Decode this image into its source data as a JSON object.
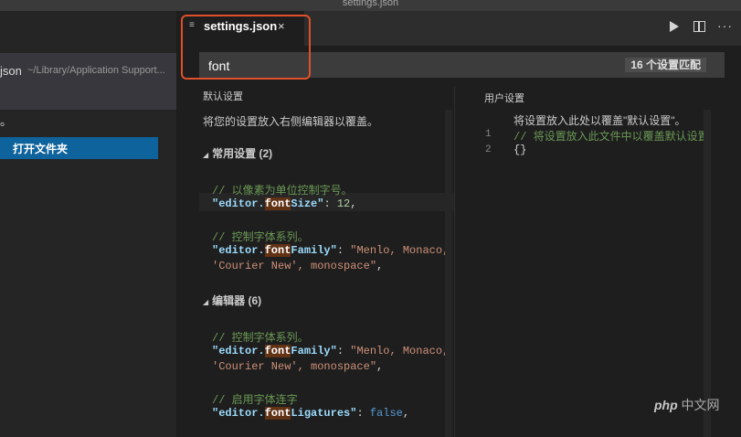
{
  "window": {
    "title": "settings.json"
  },
  "sidebar": {
    "recent_name": "json",
    "recent_path": "~/Library/Application Support...",
    "dot_text": "。",
    "open_folder_label": "打开文件夹"
  },
  "editor": {
    "tab_label": "settings.json",
    "tab_close": "×",
    "tab_icon": "≡",
    "more_label": "···"
  },
  "search": {
    "value": "font",
    "match_count": "16 个设置匹配"
  },
  "default_settings": {
    "title": "默认设置",
    "description": "将您的设置放入右侧编辑器以覆盖。",
    "groups": [
      {
        "tri": "◢",
        "header": "常用设置 (2)",
        "entries": [
          {
            "comment": "// 以像素为单位控制字号。",
            "key_prefix": "\"editor.",
            "key_hl": "font",
            "key_suffix": "Size\"",
            "colon": ": ",
            "value": "12",
            "tail": ","
          },
          {
            "comment": "// 控制字体系列。",
            "key_prefix": "\"editor.",
            "key_hl": "font",
            "key_suffix": "Family\"",
            "colon": ": ",
            "value": "\"Menlo, Monaco,",
            "value2": "'Courier New', monospace\"",
            "tail": ","
          }
        ]
      },
      {
        "tri": "◢",
        "header": "编辑器 (6)",
        "entries": [
          {
            "comment": "// 控制字体系列。",
            "key_prefix": "\"editor.",
            "key_hl": "font",
            "key_suffix": "Family\"",
            "colon": ": ",
            "value": "\"Menlo, Monaco,",
            "value2": "'Courier New', monospace\"",
            "tail": ","
          },
          {
            "comment": "// 启用字体连字",
            "key_prefix": "\"editor.",
            "key_hl": "font",
            "key_suffix": "Ligatures\"",
            "colon": ": ",
            "value": "false",
            "tail": ","
          }
        ]
      }
    ]
  },
  "user_settings": {
    "title": "用户设置",
    "description": "将设置放入此处以覆盖\"默认设置\"。",
    "lines": [
      {
        "no": "1",
        "text": "// 将设置放入此文件中以覆盖默认设置"
      },
      {
        "no": "2",
        "text": "{}"
      }
    ]
  },
  "watermark": {
    "brand": "php",
    "site": "中文网"
  },
  "colors": {
    "accent_button": "#0e639c",
    "highlight_box": "#e0502a",
    "match_highlight": "#613214"
  }
}
